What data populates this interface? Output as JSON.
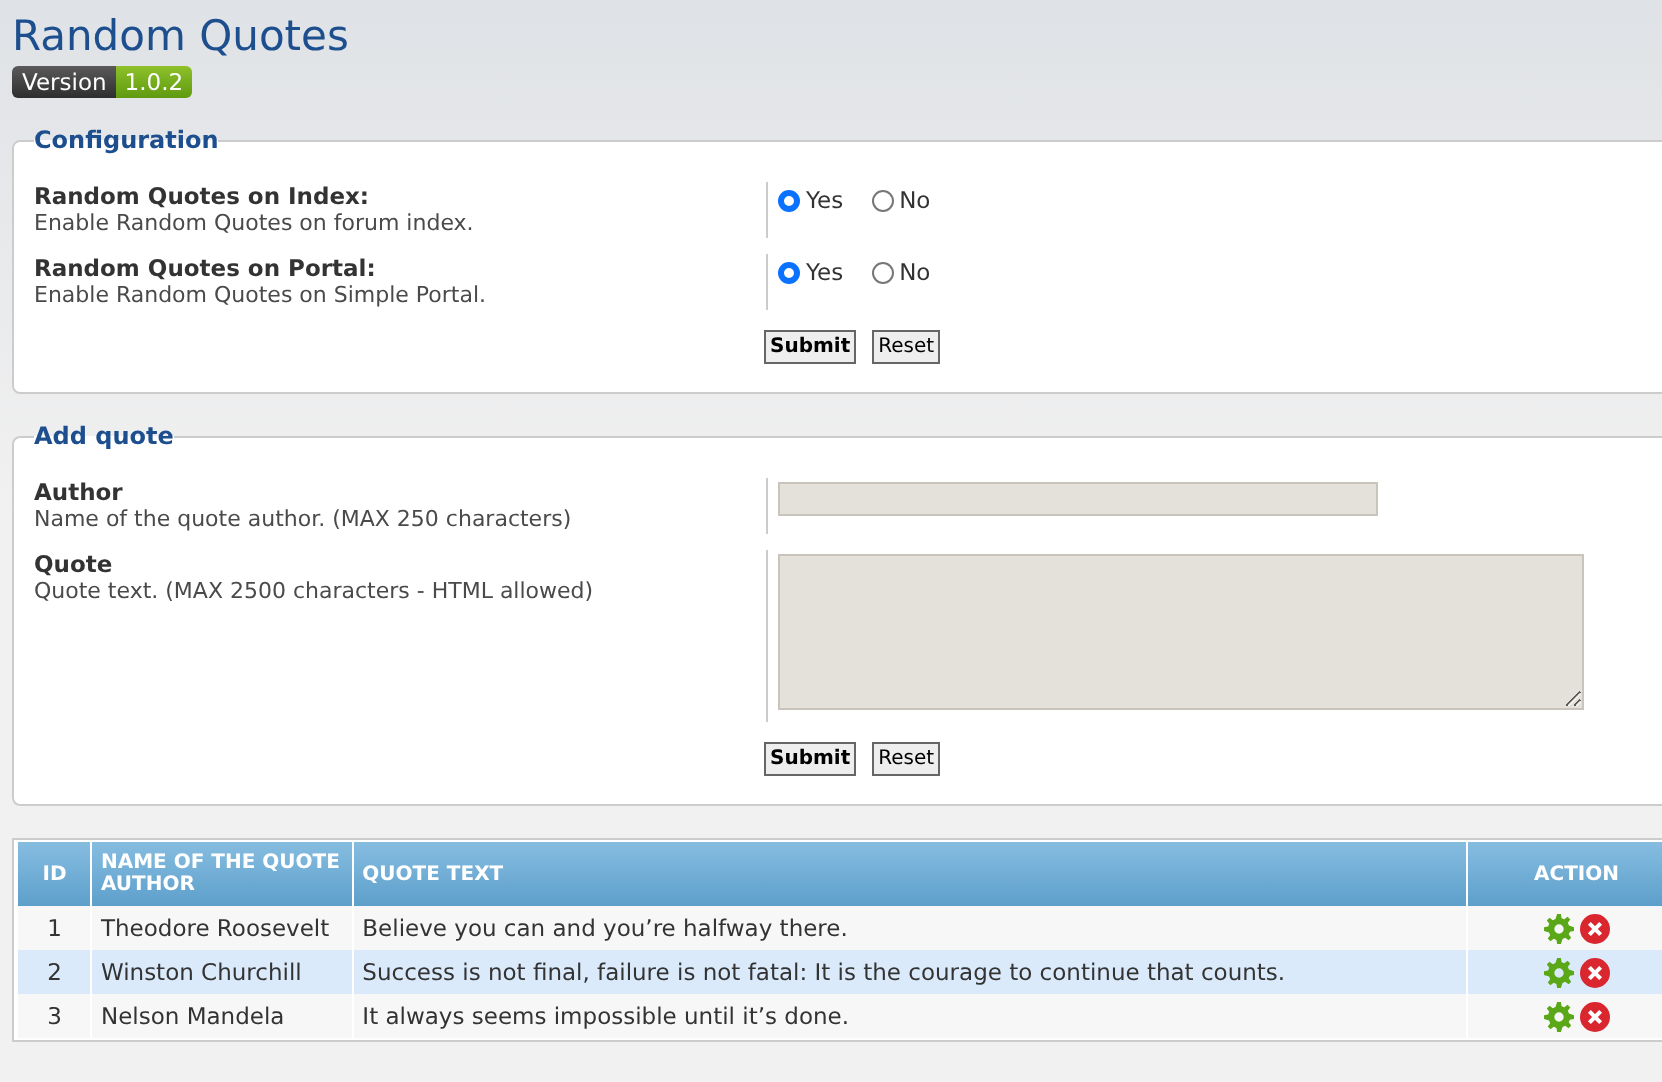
{
  "title": "Random Quotes",
  "version": {
    "label": "Version",
    "number": "1.0.2"
  },
  "configuration": {
    "legend": "Configuration",
    "settings": [
      {
        "label": "Random Quotes on Index:",
        "description": "Enable Random Quotes on forum index.",
        "options": [
          {
            "label": "Yes",
            "selected": true
          },
          {
            "label": "No",
            "selected": false
          }
        ]
      },
      {
        "label": "Random Quotes on Portal:",
        "description": "Enable Random Quotes on Simple Portal.",
        "options": [
          {
            "label": "Yes",
            "selected": true
          },
          {
            "label": "No",
            "selected": false
          }
        ]
      }
    ],
    "buttons": [
      "Submit",
      "Reset"
    ]
  },
  "add_quote": {
    "legend": "Add quote",
    "fields": [
      {
        "kind": "input",
        "label": "Author",
        "description": "Name of the quote author. (MAX 250 characters)"
      },
      {
        "kind": "textarea",
        "label": "Quote",
        "description": "Quote text. (MAX 2500 characters - HTML allowed)"
      }
    ],
    "buttons": [
      "Submit",
      "Reset"
    ]
  },
  "table": {
    "columns": [
      "ID",
      "NAME OF THE QUOTE AUTHOR",
      "QUOTE TEXT",
      "ACTION"
    ],
    "rows": [
      {
        "id": "1",
        "author": "Theodore Roosevelt",
        "quote": "Believe you can and you’re halfway there."
      },
      {
        "id": "2",
        "author": "Winston Churchill",
        "quote": "Success is not final, failure is not fatal: It is the courage to continue that counts."
      },
      {
        "id": "3",
        "author": "Nelson Mandela",
        "quote": "It always seems impossible until it’s done."
      }
    ]
  }
}
